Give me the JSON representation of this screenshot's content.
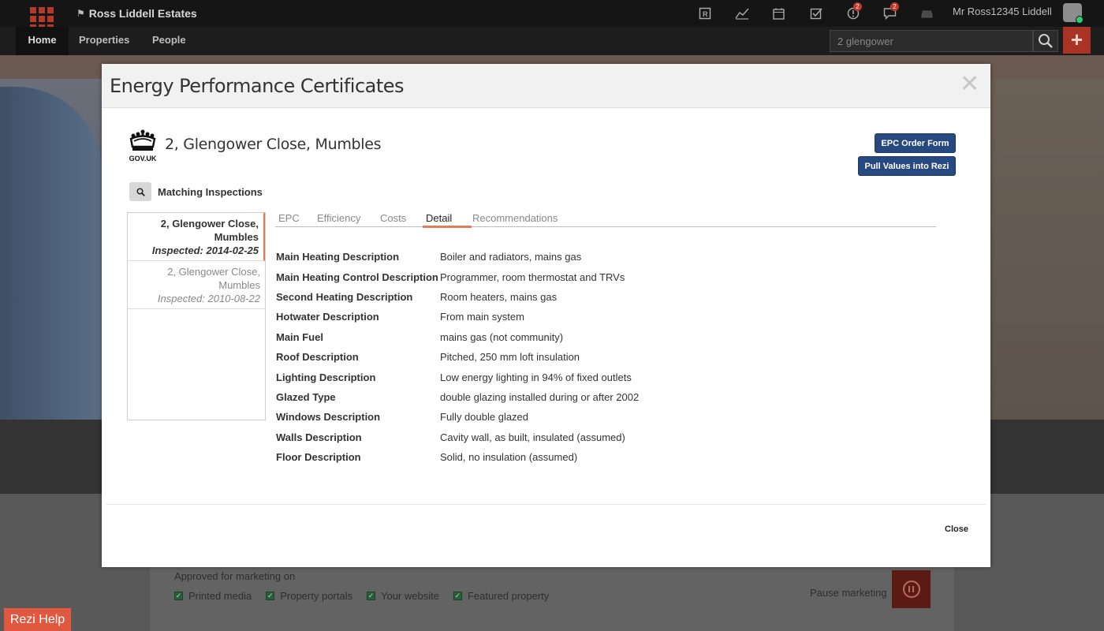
{
  "header": {
    "brand": "Ross Liddell Estates",
    "user_name": "Mr Ross12345 Liddell",
    "badges": {
      "alerts": "2",
      "messages": "2"
    },
    "nav": {
      "home": "Home",
      "properties": "Properties",
      "people": "People"
    },
    "search_value": "2 glengower"
  },
  "modal": {
    "title": "Energy Performance Certificates",
    "gov_text": "GOV.UK",
    "address": "2, Glengower Close, Mumbles",
    "buttons": {
      "epc_order": "EPC Order Form",
      "pull_values": "Pull Values into Rezi"
    },
    "matching_label": "Matching Inspections",
    "inspections": [
      {
        "address_line1": "2, Glengower Close,",
        "address_line2": "Mumbles",
        "date": "Inspected: 2014-02-25"
      },
      {
        "address_line1": "2, Glengower Close,",
        "address_line2": "Mumbles",
        "date": "Inspected: 2010-08-22"
      }
    ],
    "tabs": [
      "EPC",
      "Efficiency",
      "Costs",
      "Detail",
      "Recommendations"
    ],
    "active_tab": "Detail",
    "details": [
      {
        "key": "Main Heating Description",
        "value": "Boiler and radiators, mains gas"
      },
      {
        "key": "Main Heating Control Description",
        "value": "Programmer, room thermostat and TRVs"
      },
      {
        "key": "Second Heating Description",
        "value": "Room heaters, mains gas"
      },
      {
        "key": "Hotwater Description",
        "value": "From main system"
      },
      {
        "key": "Main Fuel",
        "value": "mains gas (not community)"
      },
      {
        "key": "Roof Description",
        "value": "Pitched, 250 mm loft insulation"
      },
      {
        "key": "Lighting Description",
        "value": "Low energy lighting in 94% of fixed outlets"
      },
      {
        "key": "Glazed Type",
        "value": "double glazing installed during or after 2002"
      },
      {
        "key": "Windows Description",
        "value": "Fully double glazed"
      },
      {
        "key": "Walls Description",
        "value": "Cavity wall, as built, insulated (assumed)"
      },
      {
        "key": "Floor Description",
        "value": "Solid, no insulation (assumed)"
      }
    ],
    "close_label": "Close"
  },
  "background": {
    "approved_label": "Approved for marketing on",
    "checks": [
      "Printed media",
      "Property portals",
      "Your website",
      "Featured property"
    ],
    "pause_label": "Pause marketing",
    "help_label": "Rezi Help"
  },
  "colors": {
    "primary_blue": "#28497f",
    "accent_orange": "#e17c5b",
    "brand_red": "#a93324",
    "help_orange": "#e0583f"
  }
}
